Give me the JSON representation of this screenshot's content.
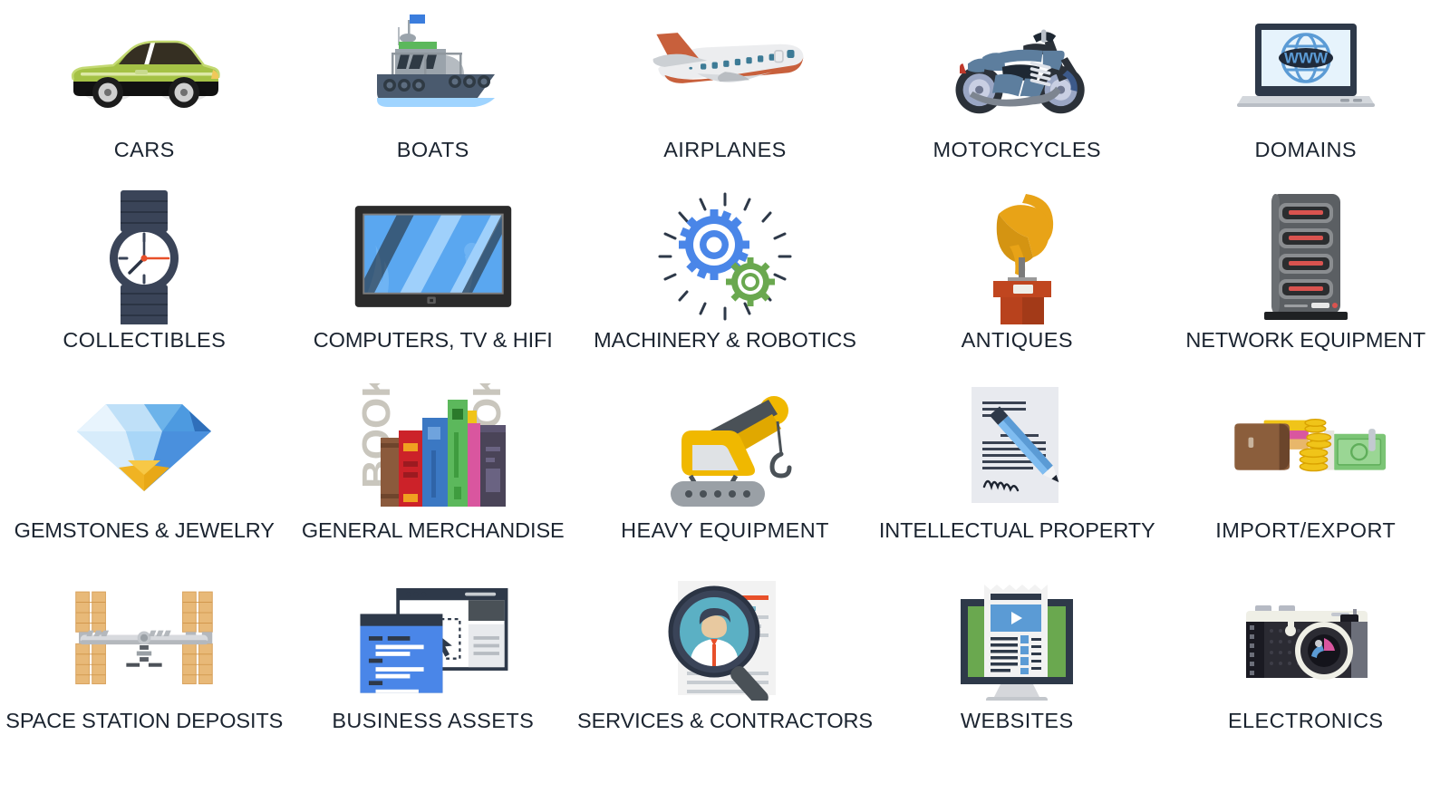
{
  "page": {
    "background_color": "#ffffff",
    "label_color": "#1b2430",
    "columns": 5,
    "rows": 4
  },
  "categories": [
    {
      "id": "cars",
      "label": "CARS",
      "icon": "car-icon",
      "colors": [
        "#a5c246",
        "#8fae3a",
        "#1a1a1a",
        "#ffffff"
      ]
    },
    {
      "id": "boats",
      "label": "BOATS",
      "icon": "boat-icon",
      "colors": [
        "#4a5a6e",
        "#9aa3ab",
        "#5cb85c",
        "#9fd4ff",
        "#3b7ddd"
      ]
    },
    {
      "id": "airplanes",
      "label": "AIRPLANES",
      "icon": "airplane-icon",
      "colors": [
        "#c8603c",
        "#e9ecef",
        "#cfd4d8",
        "#3d7b96"
      ]
    },
    {
      "id": "motorcycles",
      "label": "MOTORCYCLES",
      "icon": "motorcycle-icon",
      "colors": [
        "#5d7e9e",
        "#1e2833",
        "#9aa6c4",
        "#7d8590"
      ]
    },
    {
      "id": "domains",
      "label": "DOMAINS",
      "icon": "laptop-www-icon",
      "colors": [
        "#2e3949",
        "#e6f3fc",
        "#5b9bd5",
        "#d3d7dc"
      ]
    },
    {
      "id": "collectibles",
      "label": "COLLECTIBLES",
      "icon": "wristwatch-icon",
      "colors": [
        "#3a4458",
        "#ffffff",
        "#e8502a"
      ]
    },
    {
      "id": "computers-tv-hifi",
      "label": "COMPUTERS, TV & HIFI",
      "icon": "television-icon",
      "colors": [
        "#2b2b2b",
        "#5aa7f0",
        "#9fd0fb",
        "#7d7d7d"
      ]
    },
    {
      "id": "machinery-robotics",
      "label": "MACHINERY & ROBOTICS",
      "icon": "gears-icon",
      "colors": [
        "#4a86e8",
        "#6aa84f",
        "#2e3949"
      ]
    },
    {
      "id": "antiques",
      "label": "ANTIQUES",
      "icon": "greek-helmet-pedestal-icon",
      "colors": [
        "#e8a317",
        "#d4901a",
        "#c0461f",
        "#a33a18",
        "#6b6b6b"
      ]
    },
    {
      "id": "network-equipment",
      "label": "NETWORK EQUIPMENT",
      "icon": "server-rack-icon",
      "colors": [
        "#5b5f63",
        "#3a3d40",
        "#2b2d2f",
        "#d9534f",
        "#e8e8e8"
      ]
    },
    {
      "id": "gemstones-jewelry",
      "label": "GEMSTONES & JEWELRY",
      "icon": "diamond-icon",
      "colors": [
        "#e8f4fd",
        "#9fd0f5",
        "#5aa7e8",
        "#3178c6",
        "#f0b323"
      ]
    },
    {
      "id": "general-merchandise",
      "label": "GENERAL MERCHANDISE",
      "icon": "books-icon",
      "colors": [
        "#8b5a3c",
        "#cc2229",
        "#3b78c3",
        "#5cb85c",
        "#d9569f",
        "#4a4458",
        "#c9c6bd"
      ]
    },
    {
      "id": "heavy-equipment",
      "label": "HEAVY EQUIPMENT",
      "icon": "crane-icon",
      "colors": [
        "#f0b800",
        "#e0a800",
        "#9aa0a6",
        "#4a5157",
        "#dfe2e5"
      ]
    },
    {
      "id": "intellectual-property",
      "label": "INTELLECTUAL PROPERTY",
      "icon": "signed-document-icon",
      "colors": [
        "#e8eaef",
        "#5b9bd5",
        "#7fbcf0",
        "#2e3949"
      ]
    },
    {
      "id": "import-export",
      "label": "IMPORT/EXPORT",
      "icon": "wallet-coins-cash-icon",
      "colors": [
        "#8b5e3c",
        "#6b452b",
        "#f0c419",
        "#d9a200",
        "#7cc576",
        "#e8e6df"
      ]
    },
    {
      "id": "space-station-deposits",
      "label": "SPACE STATION DEPOSITS",
      "icon": "space-station-icon",
      "colors": [
        "#e8b978",
        "#f0cf9a",
        "#d8dade",
        "#b4b8bd",
        "#5a5f66"
      ]
    },
    {
      "id": "business-assets",
      "label": "BUSINESS ASSETS",
      "icon": "browser-windows-icon",
      "colors": [
        "#4a86e8",
        "#2e3949",
        "#ffffff",
        "#c7ccd1",
        "#e8eaed"
      ]
    },
    {
      "id": "services-contractors",
      "label": "SERVICES & CONTRACTORS",
      "icon": "resume-magnifier-icon",
      "colors": [
        "#5bb0c4",
        "#3a4458",
        "#e8c9a0",
        "#e8502a",
        "#4a5157",
        "#f2f2f2"
      ]
    },
    {
      "id": "websites",
      "label": "WEBSITES",
      "icon": "website-monitor-icon",
      "colors": [
        "#6aa84f",
        "#2e3949",
        "#5b9bd5",
        "#f2f2f2"
      ]
    },
    {
      "id": "electronics",
      "label": "ELECTRONICS",
      "icon": "camera-icon",
      "colors": [
        "#efefe6",
        "#2b2b33",
        "#8d8f9a",
        "#1a1a22"
      ]
    }
  ]
}
